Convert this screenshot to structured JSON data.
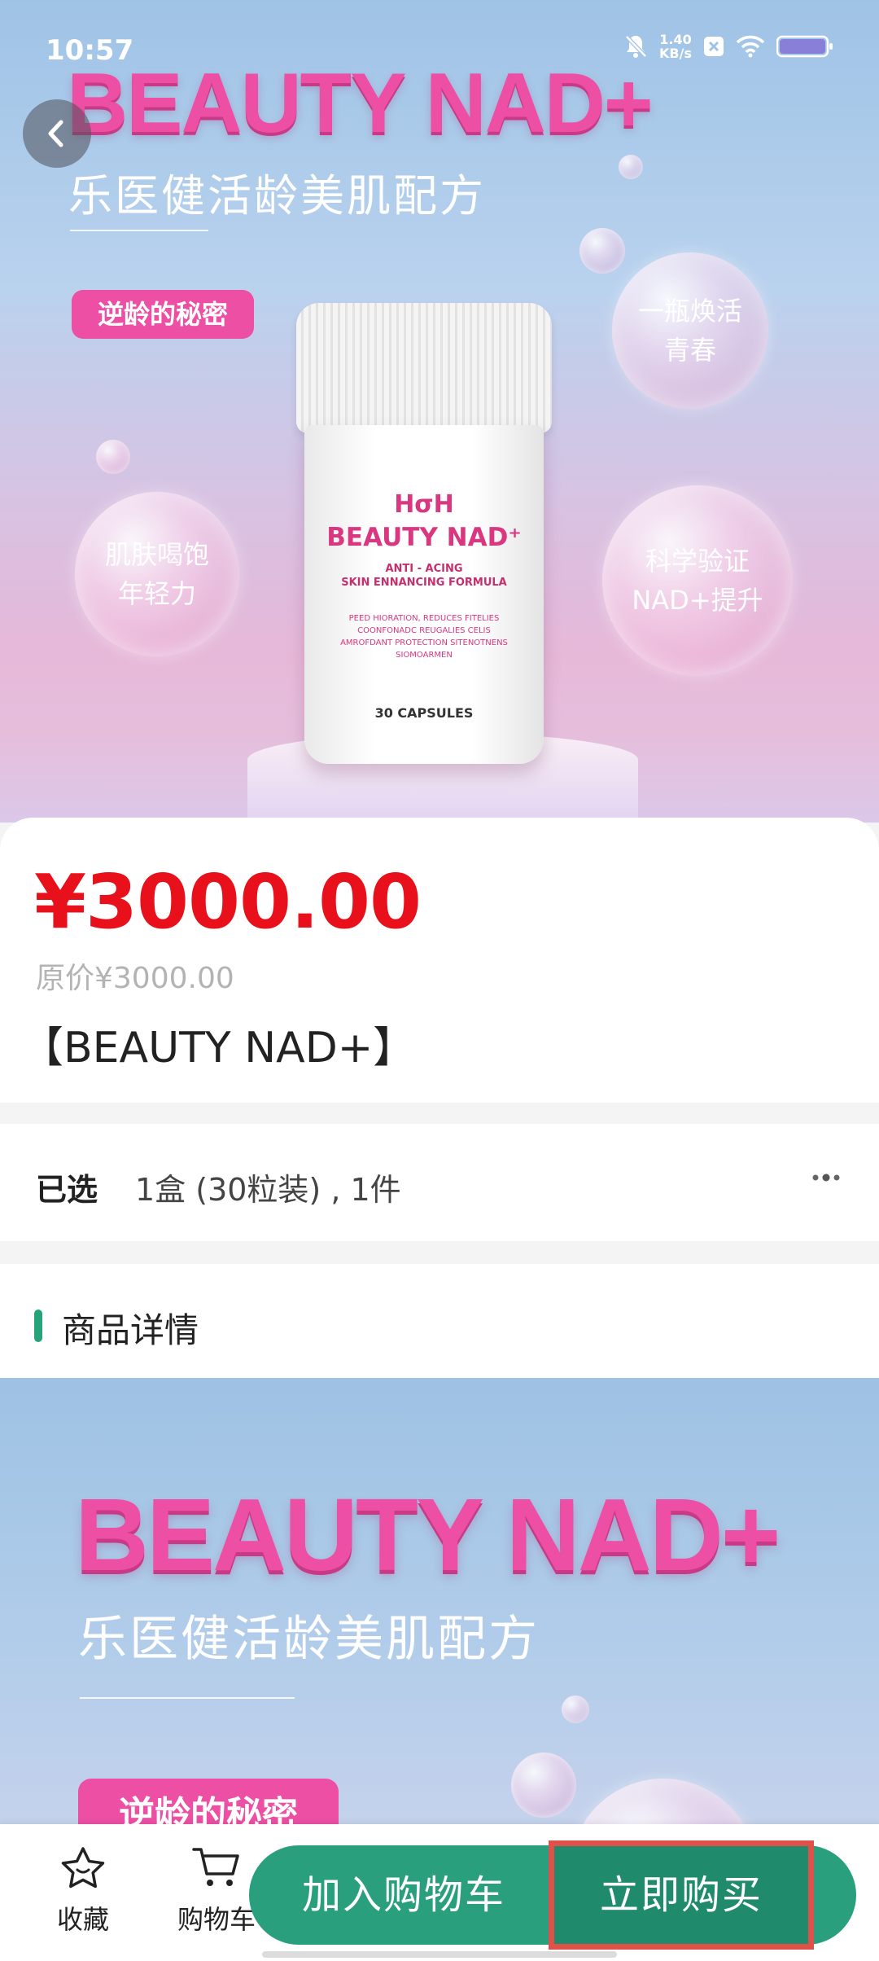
{
  "status_bar": {
    "time": "10:57",
    "net_speed_value": "1.40",
    "net_speed_unit": "KB/s"
  },
  "hero": {
    "title": "BEAUTY NAD+",
    "subtitle": "乐医健活龄美肌配方",
    "tag": "逆龄的秘密",
    "bubbles": [
      {
        "line1": "一瓶焕活",
        "line2": "青春"
      },
      {
        "line1": "肌肤喝饱",
        "line2": "年轻力"
      },
      {
        "line1": "科学验证",
        "line2": "NAD+提升"
      }
    ],
    "jar": {
      "logo": "HσH",
      "name": "BEAUTY NAD⁺",
      "sub1": "ANTI - ACING",
      "sub2": "SKIN ENNANCING FORMULA",
      "lines": "PEED HIORATION, REDUCES FITELIES COONFONADC REUGALIES CELIS AMROFDANT PROTECTION SITENOTNENS SIOMOARMEN",
      "capsules": "30 CAPSULES"
    }
  },
  "product": {
    "price": "¥3000.00",
    "original_price": "原价¥3000.00",
    "title": "【BEAUTY NAD+】"
  },
  "spec": {
    "label": "已选",
    "value": "1盒 (30粒装) , 1件"
  },
  "detail": {
    "heading": "商品详情",
    "image_title": "BEAUTY NAD+",
    "image_subtitle": "乐医健活龄美肌配方",
    "image_tag": "逆龄的秘密"
  },
  "bottom_bar": {
    "favorite_label": "收藏",
    "cart_label": "购物车",
    "add_to_cart": "加入购物车",
    "buy_now": "立即购买"
  },
  "colors": {
    "accent": "#2a9f7e",
    "price": "#e8101a",
    "brand_pink": "#ec4fa3",
    "highlight_border": "#e0514a"
  }
}
